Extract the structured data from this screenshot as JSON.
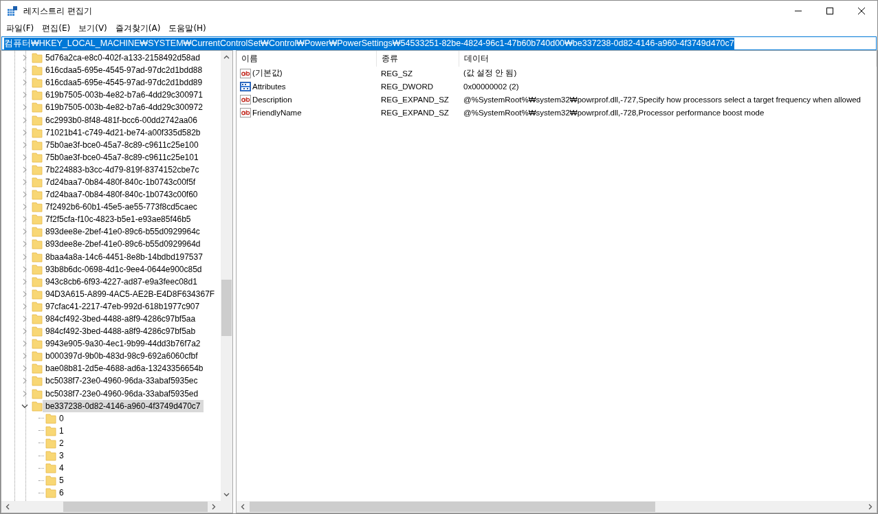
{
  "window": {
    "title": "레지스트리 편집기"
  },
  "menu": [
    "파일(F)",
    "편집(E)",
    "보기(V)",
    "즐겨찾기(A)",
    "도움말(H)"
  ],
  "address": {
    "value": "컴퓨터₩HKEY_LOCAL_MACHINE₩SYSTEM₩CurrentControlSet₩Control₩Power₩PowerSettings₩54533251-82be-4824-96c1-47b60b740d00₩be337238-0d82-4146-a960-4f3749d470c7",
    "selected": true
  },
  "tree": [
    {
      "label": "5d76a2ca-e8c0-402f-a133-2158492d58ad",
      "expanded": false,
      "selected": false
    },
    {
      "label": "616cdaa5-695e-4545-97ad-97dc2d1bdd88",
      "expanded": false,
      "selected": false
    },
    {
      "label": "616cdaa5-695e-4545-97ad-97dc2d1bdd89",
      "expanded": false,
      "selected": false
    },
    {
      "label": "619b7505-003b-4e82-b7a6-4dd29c300971",
      "expanded": false,
      "selected": false
    },
    {
      "label": "619b7505-003b-4e82-b7a6-4dd29c300972",
      "expanded": false,
      "selected": false
    },
    {
      "label": "6c2993b0-8f48-481f-bcc6-00dd2742aa06",
      "expanded": false,
      "selected": false
    },
    {
      "label": "71021b41-c749-4d21-be74-a00f335d582b",
      "expanded": false,
      "selected": false
    },
    {
      "label": "75b0ae3f-bce0-45a7-8c89-c9611c25e100",
      "expanded": false,
      "selected": false
    },
    {
      "label": "75b0ae3f-bce0-45a7-8c89-c9611c25e101",
      "expanded": false,
      "selected": false
    },
    {
      "label": "7b224883-b3cc-4d79-819f-8374152cbe7c",
      "expanded": false,
      "selected": false
    },
    {
      "label": "7d24baa7-0b84-480f-840c-1b0743c00f5f",
      "expanded": false,
      "selected": false
    },
    {
      "label": "7d24baa7-0b84-480f-840c-1b0743c00f60",
      "expanded": false,
      "selected": false
    },
    {
      "label": "7f2492b6-60b1-45e5-ae55-773f8cd5caec",
      "expanded": false,
      "selected": false
    },
    {
      "label": "7f2f5cfa-f10c-4823-b5e1-e93ae85f46b5",
      "expanded": false,
      "selected": false
    },
    {
      "label": "893dee8e-2bef-41e0-89c6-b55d0929964c",
      "expanded": false,
      "selected": false
    },
    {
      "label": "893dee8e-2bef-41e0-89c6-b55d0929964d",
      "expanded": false,
      "selected": false
    },
    {
      "label": "8baa4a8a-14c6-4451-8e8b-14bdbd197537",
      "expanded": false,
      "selected": false
    },
    {
      "label": "93b8b6dc-0698-4d1c-9ee4-0644e900c85d",
      "expanded": false,
      "selected": false
    },
    {
      "label": "943c8cb6-6f93-4227-ad87-e9a3feec08d1",
      "expanded": false,
      "selected": false
    },
    {
      "label": "94D3A615-A899-4AC5-AE2B-E4D8F634367F",
      "expanded": false,
      "selected": false
    },
    {
      "label": "97cfac41-2217-47eb-992d-618b1977c907",
      "expanded": false,
      "selected": false
    },
    {
      "label": "984cf492-3bed-4488-a8f9-4286c97bf5aa",
      "expanded": false,
      "selected": false
    },
    {
      "label": "984cf492-3bed-4488-a8f9-4286c97bf5ab",
      "expanded": false,
      "selected": false
    },
    {
      "label": "9943e905-9a30-4ec1-9b99-44dd3b76f7a2",
      "expanded": false,
      "selected": false
    },
    {
      "label": "b000397d-9b0b-483d-98c9-692a6060cfbf",
      "expanded": false,
      "selected": false
    },
    {
      "label": "bae08b81-2d5e-4688-ad6a-13243356654b",
      "expanded": false,
      "selected": false
    },
    {
      "label": "bc5038f7-23e0-4960-96da-33abaf5935ec",
      "expanded": false,
      "selected": false
    },
    {
      "label": "bc5038f7-23e0-4960-96da-33abaf5935ed",
      "expanded": false,
      "selected": false
    },
    {
      "label": "be337238-0d82-4146-a960-4f3749d470c7",
      "expanded": true,
      "selected": true,
      "children": [
        {
          "label": "0",
          "selected": false
        },
        {
          "label": "1",
          "selected": false
        },
        {
          "label": "2",
          "selected": false
        },
        {
          "label": "3",
          "selected": false
        },
        {
          "label": "4",
          "selected": false
        },
        {
          "label": "5",
          "selected": false
        },
        {
          "label": "6",
          "selected": false
        }
      ]
    }
  ],
  "values": {
    "columns": [
      "이름",
      "종류",
      "데이터"
    ],
    "rows": [
      {
        "kind": "string",
        "name": "(기본값)",
        "type": "REG_SZ",
        "data": "(값 설정 안 됨)"
      },
      {
        "kind": "binary",
        "name": "Attributes",
        "type": "REG_DWORD",
        "data": "0x00000002 (2)"
      },
      {
        "kind": "string",
        "name": "Description",
        "type": "REG_EXPAND_SZ",
        "data": "@%SystemRoot%₩system32₩powrprof.dll,-727,Specify how processors select a target frequency when allowed"
      },
      {
        "kind": "string",
        "name": "FriendlyName",
        "type": "REG_EXPAND_SZ",
        "data": "@%SystemRoot%₩system32₩powrprof.dll,-728,Processor performance boost mode"
      }
    ]
  }
}
